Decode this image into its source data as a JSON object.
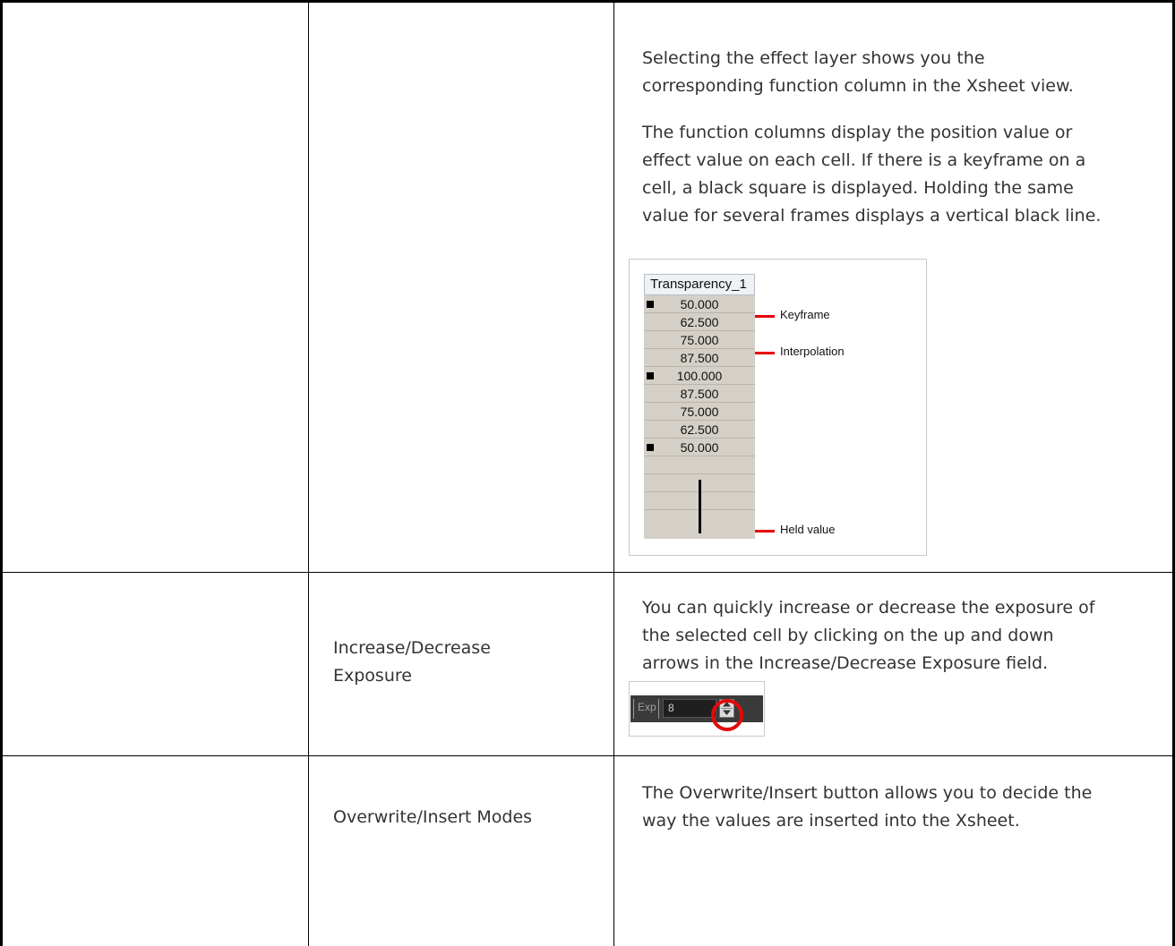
{
  "rows": [
    {
      "label": "",
      "paragraphs": [
        [
          "Selecting the effect layer shows you the",
          "corresponding function column in the Xsheet view."
        ],
        [
          "The function columns display the position value or",
          "effect value on each cell. If there is a keyframe on a",
          "cell, a black square is displayed. Holding the same",
          "value for several frames displays a vertical black line."
        ]
      ],
      "figure": {
        "header": "Transparency_1",
        "cells": [
          {
            "value": "50.000",
            "keyframe": true
          },
          {
            "value": "62.500",
            "keyframe": false
          },
          {
            "value": "75.000",
            "keyframe": false
          },
          {
            "value": "87.500",
            "keyframe": false
          },
          {
            "value": "100.000",
            "keyframe": true
          },
          {
            "value": "87.500",
            "keyframe": false
          },
          {
            "value": "75.000",
            "keyframe": false
          },
          {
            "value": "62.500",
            "keyframe": false
          },
          {
            "value": "50.000",
            "keyframe": true
          },
          {
            "value": "",
            "keyframe": false
          },
          {
            "value": "",
            "keyframe": false
          },
          {
            "value": "",
            "keyframe": false
          }
        ],
        "callouts": [
          "Keyframe",
          "Interpolation",
          "Held value"
        ]
      }
    },
    {
      "label": [
        "Increase/Decrease",
        "Exposure"
      ],
      "paragraphs": [
        [
          "You can quickly increase or decrease the exposure of",
          "the selected cell by clicking on the up and down",
          "arrows in the Increase/Decrease Exposure field."
        ]
      ],
      "figure": {
        "field_label": "Exp",
        "field_value": "8",
        "highlight_color": "#e10b0b"
      }
    },
    {
      "label": "Overwrite/Insert Modes",
      "paragraphs": [
        [
          "The Overwrite/Insert button allows you to decide the",
          "way the values are inserted into the Xsheet."
        ]
      ]
    }
  ]
}
